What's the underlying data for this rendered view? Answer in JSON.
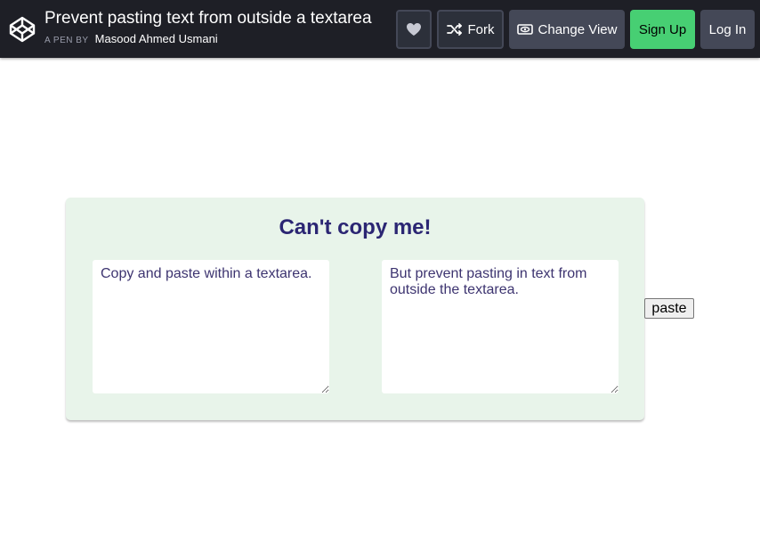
{
  "header": {
    "title": "Prevent pasting text from outside a textarea",
    "byline_prefix": "A PEN BY",
    "author": "Masood Ahmed Usmani",
    "fork_label": "Fork",
    "change_view_label": "Change View",
    "signup_label": "Sign Up",
    "login_label": "Log In"
  },
  "main": {
    "heading": "Can't copy me!",
    "left_textarea": "Copy and paste within a textarea.",
    "right_textarea": "But prevent pasting in text from outside the textarea.",
    "paste_label": "paste"
  },
  "icons": {
    "logo": "codepen-logo-icon",
    "like": "heart-icon",
    "fork": "fork-icon",
    "view": "eye-icon"
  },
  "colors": {
    "header_bg": "#1e1f26",
    "signup_bg": "#47cf73",
    "card_bg": "#e8f4ea",
    "heading": "#2b2673"
  }
}
